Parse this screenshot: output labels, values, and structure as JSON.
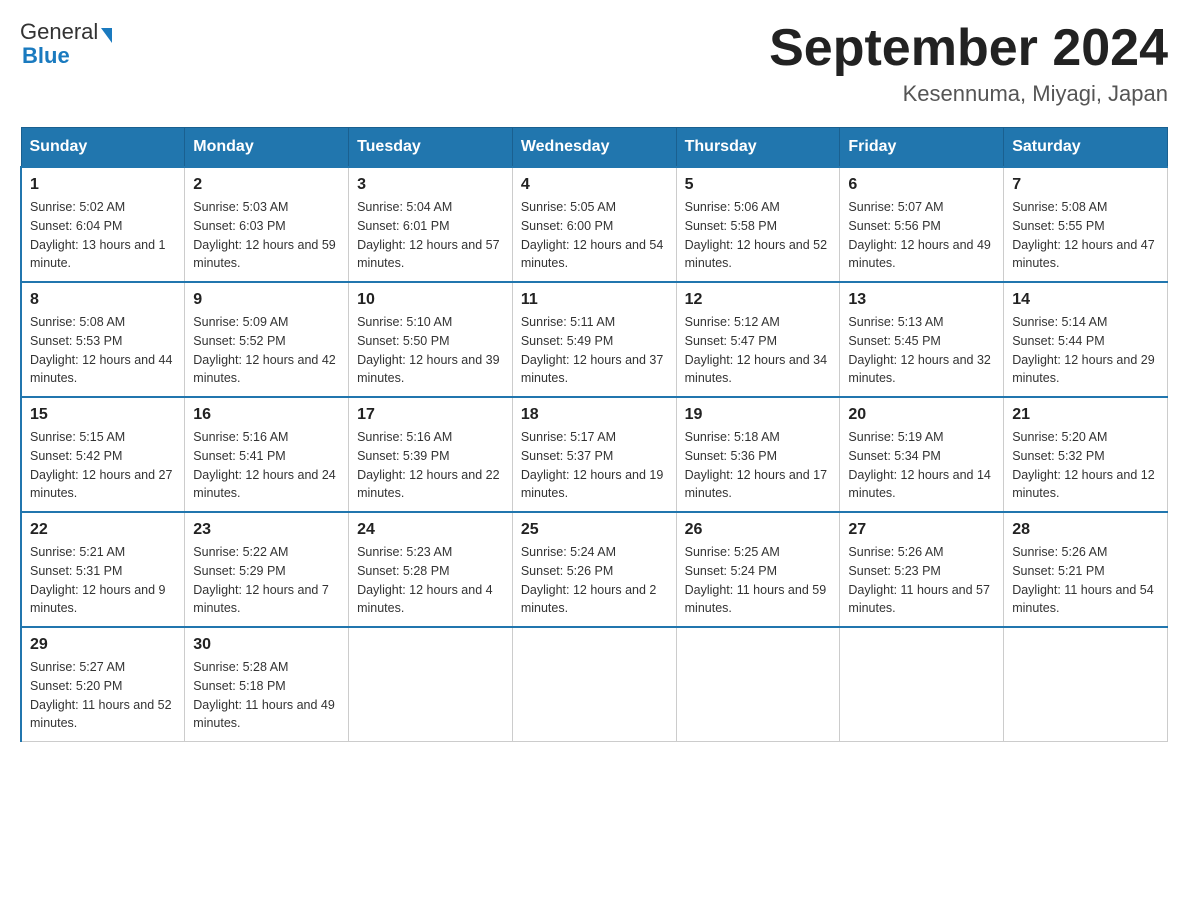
{
  "header": {
    "logo": {
      "general": "General",
      "blue": "Blue"
    },
    "title": "September 2024",
    "subtitle": "Kesennuma, Miyagi, Japan"
  },
  "calendar": {
    "headers": [
      "Sunday",
      "Monday",
      "Tuesday",
      "Wednesday",
      "Thursday",
      "Friday",
      "Saturday"
    ],
    "weeks": [
      [
        {
          "day": "1",
          "sunrise": "5:02 AM",
          "sunset": "6:04 PM",
          "daylight": "13 hours and 1 minute."
        },
        {
          "day": "2",
          "sunrise": "5:03 AM",
          "sunset": "6:03 PM",
          "daylight": "12 hours and 59 minutes."
        },
        {
          "day": "3",
          "sunrise": "5:04 AM",
          "sunset": "6:01 PM",
          "daylight": "12 hours and 57 minutes."
        },
        {
          "day": "4",
          "sunrise": "5:05 AM",
          "sunset": "6:00 PM",
          "daylight": "12 hours and 54 minutes."
        },
        {
          "day": "5",
          "sunrise": "5:06 AM",
          "sunset": "5:58 PM",
          "daylight": "12 hours and 52 minutes."
        },
        {
          "day": "6",
          "sunrise": "5:07 AM",
          "sunset": "5:56 PM",
          "daylight": "12 hours and 49 minutes."
        },
        {
          "day": "7",
          "sunrise": "5:08 AM",
          "sunset": "5:55 PM",
          "daylight": "12 hours and 47 minutes."
        }
      ],
      [
        {
          "day": "8",
          "sunrise": "5:08 AM",
          "sunset": "5:53 PM",
          "daylight": "12 hours and 44 minutes."
        },
        {
          "day": "9",
          "sunrise": "5:09 AM",
          "sunset": "5:52 PM",
          "daylight": "12 hours and 42 minutes."
        },
        {
          "day": "10",
          "sunrise": "5:10 AM",
          "sunset": "5:50 PM",
          "daylight": "12 hours and 39 minutes."
        },
        {
          "day": "11",
          "sunrise": "5:11 AM",
          "sunset": "5:49 PM",
          "daylight": "12 hours and 37 minutes."
        },
        {
          "day": "12",
          "sunrise": "5:12 AM",
          "sunset": "5:47 PM",
          "daylight": "12 hours and 34 minutes."
        },
        {
          "day": "13",
          "sunrise": "5:13 AM",
          "sunset": "5:45 PM",
          "daylight": "12 hours and 32 minutes."
        },
        {
          "day": "14",
          "sunrise": "5:14 AM",
          "sunset": "5:44 PM",
          "daylight": "12 hours and 29 minutes."
        }
      ],
      [
        {
          "day": "15",
          "sunrise": "5:15 AM",
          "sunset": "5:42 PM",
          "daylight": "12 hours and 27 minutes."
        },
        {
          "day": "16",
          "sunrise": "5:16 AM",
          "sunset": "5:41 PM",
          "daylight": "12 hours and 24 minutes."
        },
        {
          "day": "17",
          "sunrise": "5:16 AM",
          "sunset": "5:39 PM",
          "daylight": "12 hours and 22 minutes."
        },
        {
          "day": "18",
          "sunrise": "5:17 AM",
          "sunset": "5:37 PM",
          "daylight": "12 hours and 19 minutes."
        },
        {
          "day": "19",
          "sunrise": "5:18 AM",
          "sunset": "5:36 PM",
          "daylight": "12 hours and 17 minutes."
        },
        {
          "day": "20",
          "sunrise": "5:19 AM",
          "sunset": "5:34 PM",
          "daylight": "12 hours and 14 minutes."
        },
        {
          "day": "21",
          "sunrise": "5:20 AM",
          "sunset": "5:32 PM",
          "daylight": "12 hours and 12 minutes."
        }
      ],
      [
        {
          "day": "22",
          "sunrise": "5:21 AM",
          "sunset": "5:31 PM",
          "daylight": "12 hours and 9 minutes."
        },
        {
          "day": "23",
          "sunrise": "5:22 AM",
          "sunset": "5:29 PM",
          "daylight": "12 hours and 7 minutes."
        },
        {
          "day": "24",
          "sunrise": "5:23 AM",
          "sunset": "5:28 PM",
          "daylight": "12 hours and 4 minutes."
        },
        {
          "day": "25",
          "sunrise": "5:24 AM",
          "sunset": "5:26 PM",
          "daylight": "12 hours and 2 minutes."
        },
        {
          "day": "26",
          "sunrise": "5:25 AM",
          "sunset": "5:24 PM",
          "daylight": "11 hours and 59 minutes."
        },
        {
          "day": "27",
          "sunrise": "5:26 AM",
          "sunset": "5:23 PM",
          "daylight": "11 hours and 57 minutes."
        },
        {
          "day": "28",
          "sunrise": "5:26 AM",
          "sunset": "5:21 PM",
          "daylight": "11 hours and 54 minutes."
        }
      ],
      [
        {
          "day": "29",
          "sunrise": "5:27 AM",
          "sunset": "5:20 PM",
          "daylight": "11 hours and 52 minutes."
        },
        {
          "day": "30",
          "sunrise": "5:28 AM",
          "sunset": "5:18 PM",
          "daylight": "11 hours and 49 minutes."
        },
        null,
        null,
        null,
        null,
        null
      ]
    ]
  }
}
